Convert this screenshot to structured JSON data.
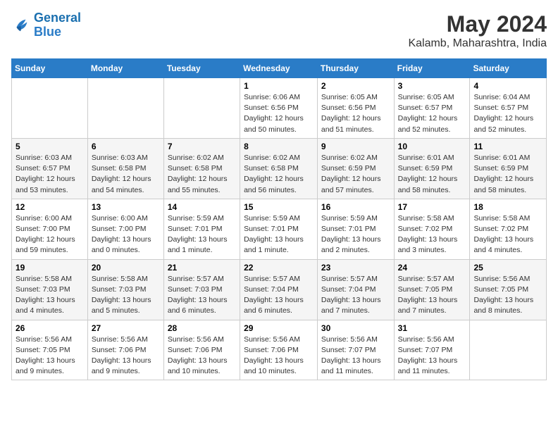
{
  "logo": {
    "line1": "General",
    "line2": "Blue"
  },
  "title": "May 2024",
  "subtitle": "Kalamb, Maharashtra, India",
  "days_of_week": [
    "Sunday",
    "Monday",
    "Tuesday",
    "Wednesday",
    "Thursday",
    "Friday",
    "Saturday"
  ],
  "weeks": [
    [
      {
        "day": "",
        "info": ""
      },
      {
        "day": "",
        "info": ""
      },
      {
        "day": "",
        "info": ""
      },
      {
        "day": "1",
        "info": "Sunrise: 6:06 AM\nSunset: 6:56 PM\nDaylight: 12 hours\nand 50 minutes."
      },
      {
        "day": "2",
        "info": "Sunrise: 6:05 AM\nSunset: 6:56 PM\nDaylight: 12 hours\nand 51 minutes."
      },
      {
        "day": "3",
        "info": "Sunrise: 6:05 AM\nSunset: 6:57 PM\nDaylight: 12 hours\nand 52 minutes."
      },
      {
        "day": "4",
        "info": "Sunrise: 6:04 AM\nSunset: 6:57 PM\nDaylight: 12 hours\nand 52 minutes."
      }
    ],
    [
      {
        "day": "5",
        "info": "Sunrise: 6:03 AM\nSunset: 6:57 PM\nDaylight: 12 hours\nand 53 minutes."
      },
      {
        "day": "6",
        "info": "Sunrise: 6:03 AM\nSunset: 6:58 PM\nDaylight: 12 hours\nand 54 minutes."
      },
      {
        "day": "7",
        "info": "Sunrise: 6:02 AM\nSunset: 6:58 PM\nDaylight: 12 hours\nand 55 minutes."
      },
      {
        "day": "8",
        "info": "Sunrise: 6:02 AM\nSunset: 6:58 PM\nDaylight: 12 hours\nand 56 minutes."
      },
      {
        "day": "9",
        "info": "Sunrise: 6:02 AM\nSunset: 6:59 PM\nDaylight: 12 hours\nand 57 minutes."
      },
      {
        "day": "10",
        "info": "Sunrise: 6:01 AM\nSunset: 6:59 PM\nDaylight: 12 hours\nand 58 minutes."
      },
      {
        "day": "11",
        "info": "Sunrise: 6:01 AM\nSunset: 6:59 PM\nDaylight: 12 hours\nand 58 minutes."
      }
    ],
    [
      {
        "day": "12",
        "info": "Sunrise: 6:00 AM\nSunset: 7:00 PM\nDaylight: 12 hours\nand 59 minutes."
      },
      {
        "day": "13",
        "info": "Sunrise: 6:00 AM\nSunset: 7:00 PM\nDaylight: 13 hours\nand 0 minutes."
      },
      {
        "day": "14",
        "info": "Sunrise: 5:59 AM\nSunset: 7:01 PM\nDaylight: 13 hours\nand 1 minute."
      },
      {
        "day": "15",
        "info": "Sunrise: 5:59 AM\nSunset: 7:01 PM\nDaylight: 13 hours\nand 1 minute."
      },
      {
        "day": "16",
        "info": "Sunrise: 5:59 AM\nSunset: 7:01 PM\nDaylight: 13 hours\nand 2 minutes."
      },
      {
        "day": "17",
        "info": "Sunrise: 5:58 AM\nSunset: 7:02 PM\nDaylight: 13 hours\nand 3 minutes."
      },
      {
        "day": "18",
        "info": "Sunrise: 5:58 AM\nSunset: 7:02 PM\nDaylight: 13 hours\nand 4 minutes."
      }
    ],
    [
      {
        "day": "19",
        "info": "Sunrise: 5:58 AM\nSunset: 7:03 PM\nDaylight: 13 hours\nand 4 minutes."
      },
      {
        "day": "20",
        "info": "Sunrise: 5:58 AM\nSunset: 7:03 PM\nDaylight: 13 hours\nand 5 minutes."
      },
      {
        "day": "21",
        "info": "Sunrise: 5:57 AM\nSunset: 7:03 PM\nDaylight: 13 hours\nand 6 minutes."
      },
      {
        "day": "22",
        "info": "Sunrise: 5:57 AM\nSunset: 7:04 PM\nDaylight: 13 hours\nand 6 minutes."
      },
      {
        "day": "23",
        "info": "Sunrise: 5:57 AM\nSunset: 7:04 PM\nDaylight: 13 hours\nand 7 minutes."
      },
      {
        "day": "24",
        "info": "Sunrise: 5:57 AM\nSunset: 7:05 PM\nDaylight: 13 hours\nand 7 minutes."
      },
      {
        "day": "25",
        "info": "Sunrise: 5:56 AM\nSunset: 7:05 PM\nDaylight: 13 hours\nand 8 minutes."
      }
    ],
    [
      {
        "day": "26",
        "info": "Sunrise: 5:56 AM\nSunset: 7:05 PM\nDaylight: 13 hours\nand 9 minutes."
      },
      {
        "day": "27",
        "info": "Sunrise: 5:56 AM\nSunset: 7:06 PM\nDaylight: 13 hours\nand 9 minutes."
      },
      {
        "day": "28",
        "info": "Sunrise: 5:56 AM\nSunset: 7:06 PM\nDaylight: 13 hours\nand 10 minutes."
      },
      {
        "day": "29",
        "info": "Sunrise: 5:56 AM\nSunset: 7:06 PM\nDaylight: 13 hours\nand 10 minutes."
      },
      {
        "day": "30",
        "info": "Sunrise: 5:56 AM\nSunset: 7:07 PM\nDaylight: 13 hours\nand 11 minutes."
      },
      {
        "day": "31",
        "info": "Sunrise: 5:56 AM\nSunset: 7:07 PM\nDaylight: 13 hours\nand 11 minutes."
      },
      {
        "day": "",
        "info": ""
      }
    ]
  ]
}
